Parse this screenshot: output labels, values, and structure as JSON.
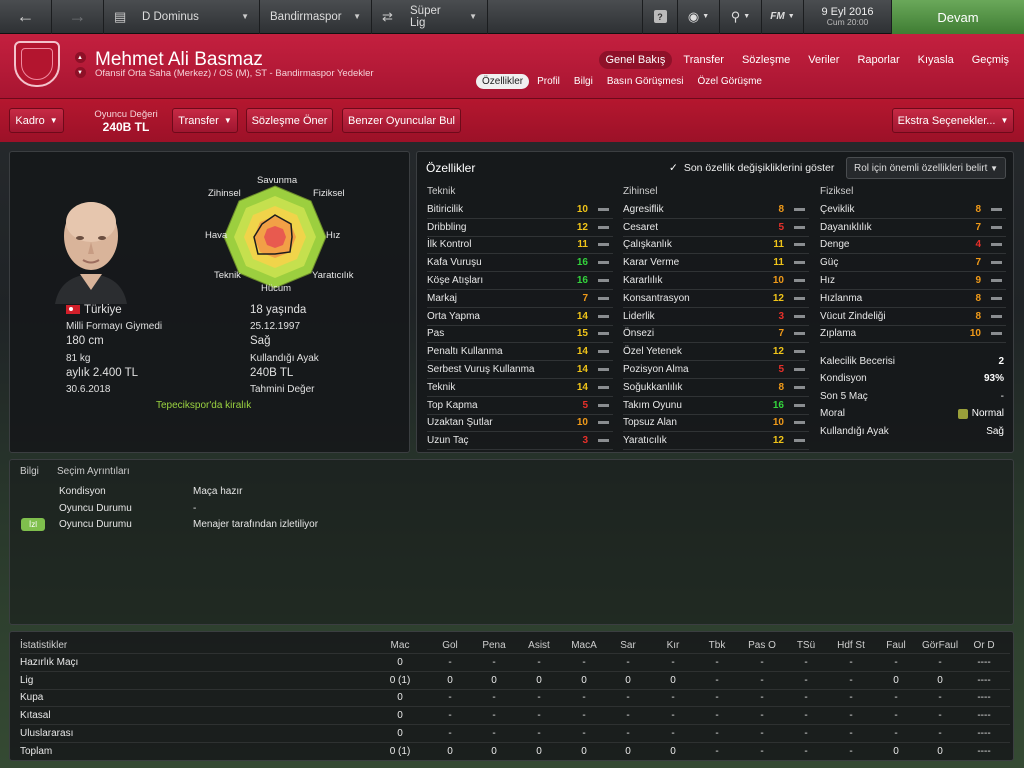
{
  "topbar": {
    "back": "←",
    "forward": "→",
    "manager": "D Dominus",
    "club": "Bandirmaspor",
    "league": "Süper Lig",
    "date": "9 Eyl 2016",
    "day_time": "Cum 20:00",
    "help": "?",
    "fm_menu": "FM",
    "continue": "Devam"
  },
  "player": {
    "name": "Mehmet Ali Basmaz",
    "subtitle": "Ofansif Orta Saha (Merkez) / OS (M), ST - Bandirmaspor Yedekler"
  },
  "main_tabs": [
    "Genel Bakış",
    "Transfer",
    "Sözleşme",
    "Veriler",
    "Raporlar",
    "Kıyasla",
    "Geçmiş"
  ],
  "sub_tabs": [
    "Özellikler",
    "Profil",
    "Bilgi",
    "Basın Görüşmesi",
    "Özel Görüşme"
  ],
  "actions": {
    "squad": "Kadro",
    "value_label": "Oyuncu Değeri",
    "value": "240B TL",
    "transfer": "Transfer",
    "offer_contract": "Sözleşme Öner",
    "find_similar": "Benzer Oyuncular Bul",
    "extra_options": "Ekstra Seçenekler..."
  },
  "profile": {
    "nationality": "Türkiye",
    "national_caps": "Milli Formayı Giymedi",
    "height": "180 cm",
    "weight": "81 kg",
    "wage": "aylık 2.400 TL",
    "contract_end": "30.6.2018",
    "age": "18 yaşında",
    "birthdate": "25.12.1997",
    "preferred_foot": "Sağ",
    "preferred_foot_label": "Kullandığı Ayak",
    "value": "240B TL",
    "value_label": "Tahmini Değer",
    "loan_status": "Tepecikspor'da kiralık"
  },
  "radar": {
    "labels": {
      "defending": "Savunma",
      "physical": "Fiziksel",
      "speed": "Hız",
      "vision": "Yaratıcılık",
      "attacking": "Hücum",
      "technique": "Teknik",
      "aerial": "Hava",
      "mental": "Zihinsel"
    }
  },
  "attributes": {
    "title": "Özellikler",
    "show_changes": "Son özellik değişikliklerini göster",
    "role_select": "Rol için önemli özellikleri belirt",
    "technical_header": "Teknik",
    "mental_header": "Zihinsel",
    "physical_header": "Fiziksel",
    "technical": [
      {
        "name": "Bitiricilik",
        "value": "10",
        "tier": "yellow"
      },
      {
        "name": "Dribbling",
        "value": "12",
        "tier": "yellow"
      },
      {
        "name": "İlk Kontrol",
        "value": "11",
        "tier": "yellow"
      },
      {
        "name": "Kafa Vuruşu",
        "value": "16",
        "tier": "green"
      },
      {
        "name": "Köşe Atışları",
        "value": "16",
        "tier": "green"
      },
      {
        "name": "Markaj",
        "value": "7",
        "tier": "orange"
      },
      {
        "name": "Orta Yapma",
        "value": "14",
        "tier": "yellow"
      },
      {
        "name": "Pas",
        "value": "15",
        "tier": "yellow"
      },
      {
        "name": "Penaltı Kullanma",
        "value": "14",
        "tier": "yellow"
      },
      {
        "name": "Serbest Vuruş Kullanma",
        "value": "14",
        "tier": "yellow"
      },
      {
        "name": "Teknik",
        "value": "14",
        "tier": "yellow"
      },
      {
        "name": "Top Kapma",
        "value": "5",
        "tier": "red"
      },
      {
        "name": "Uzaktan Şutlar",
        "value": "10",
        "tier": "orange"
      },
      {
        "name": "Uzun Taç",
        "value": "3",
        "tier": "red"
      }
    ],
    "mental": [
      {
        "name": "Agresiflik",
        "value": "8",
        "tier": "orange"
      },
      {
        "name": "Cesaret",
        "value": "5",
        "tier": "red"
      },
      {
        "name": "Çalışkanlık",
        "value": "11",
        "tier": "yellow"
      },
      {
        "name": "Karar Verme",
        "value": "11",
        "tier": "yellow"
      },
      {
        "name": "Kararlılık",
        "value": "10",
        "tier": "orange"
      },
      {
        "name": "Konsantrasyon",
        "value": "12",
        "tier": "yellow"
      },
      {
        "name": "Liderlik",
        "value": "3",
        "tier": "red"
      },
      {
        "name": "Önsezi",
        "value": "7",
        "tier": "orange"
      },
      {
        "name": "Özel Yetenek",
        "value": "12",
        "tier": "yellow"
      },
      {
        "name": "Pozisyon Alma",
        "value": "5",
        "tier": "red"
      },
      {
        "name": "Soğukkanlılık",
        "value": "8",
        "tier": "orange"
      },
      {
        "name": "Takım Oyunu",
        "value": "16",
        "tier": "green"
      },
      {
        "name": "Topsuz Alan",
        "value": "10",
        "tier": "orange"
      },
      {
        "name": "Yaratıcılık",
        "value": "12",
        "tier": "yellow"
      }
    ],
    "physical": [
      {
        "name": "Çeviklik",
        "value": "8",
        "tier": "orange"
      },
      {
        "name": "Dayanıklılık",
        "value": "7",
        "tier": "orange"
      },
      {
        "name": "Denge",
        "value": "4",
        "tier": "red"
      },
      {
        "name": "Güç",
        "value": "7",
        "tier": "orange"
      },
      {
        "name": "Hız",
        "value": "9",
        "tier": "orange"
      },
      {
        "name": "Hızlanma",
        "value": "8",
        "tier": "orange"
      },
      {
        "name": "Vücut Zindeliği",
        "value": "8",
        "tier": "orange"
      },
      {
        "name": "Zıplama",
        "value": "10",
        "tier": "orange"
      }
    ],
    "extra": [
      {
        "name": "Kalecilik Becerisi",
        "value": "2"
      },
      {
        "name": "Kondisyon",
        "value": "93%"
      },
      {
        "name": "Son 5 Maç",
        "value": "-"
      },
      {
        "name": "Moral",
        "value": "Normal"
      },
      {
        "name": "Kullandığı Ayak",
        "value": "Sağ"
      }
    ]
  },
  "info_panel": {
    "tab_info": "Bilgi",
    "tab_selection": "Seçim Ayrıntıları",
    "rows": [
      {
        "label": "Kondisyon",
        "value": "Maça hazır"
      },
      {
        "label": "Oyuncu Durumu",
        "value": "-"
      },
      {
        "label": "Oyuncu Durumu",
        "value": "Menajer tarafından izletiliyor"
      }
    ],
    "badge": "İzl"
  },
  "stats": {
    "title": "İstatistikler",
    "columns": [
      "Mac",
      "Gol",
      "Pena",
      "Asist",
      "MacA",
      "Sar",
      "Kır",
      "Tbk",
      "Pas O",
      "TSü",
      "Hdf St",
      "Faul",
      "GörFaul",
      "Or D"
    ],
    "rows": [
      {
        "label": "Hazırlık Maçı",
        "cells": [
          "0",
          "-",
          "-",
          "-",
          "-",
          "-",
          "-",
          "-",
          "-",
          "-",
          "-",
          "-",
          "-",
          "----"
        ]
      },
      {
        "label": "Lig",
        "cells": [
          "0 (1)",
          "0",
          "0",
          "0",
          "0",
          "0",
          "0",
          "-",
          "-",
          "-",
          "-",
          "0",
          "0",
          "----"
        ]
      },
      {
        "label": "Kupa",
        "cells": [
          "0",
          "-",
          "-",
          "-",
          "-",
          "-",
          "-",
          "-",
          "-",
          "-",
          "-",
          "-",
          "-",
          "----"
        ]
      },
      {
        "label": "Kıtasal",
        "cells": [
          "0",
          "-",
          "-",
          "-",
          "-",
          "-",
          "-",
          "-",
          "-",
          "-",
          "-",
          "-",
          "-",
          "----"
        ]
      },
      {
        "label": "Uluslararası",
        "cells": [
          "0",
          "-",
          "-",
          "-",
          "-",
          "-",
          "-",
          "-",
          "-",
          "-",
          "-",
          "-",
          "-",
          "----"
        ]
      },
      {
        "label": "Toplam",
        "cells": [
          "0 (1)",
          "0",
          "0",
          "0",
          "0",
          "0",
          "0",
          "-",
          "-",
          "-",
          "-",
          "0",
          "0",
          "----"
        ]
      }
    ]
  }
}
